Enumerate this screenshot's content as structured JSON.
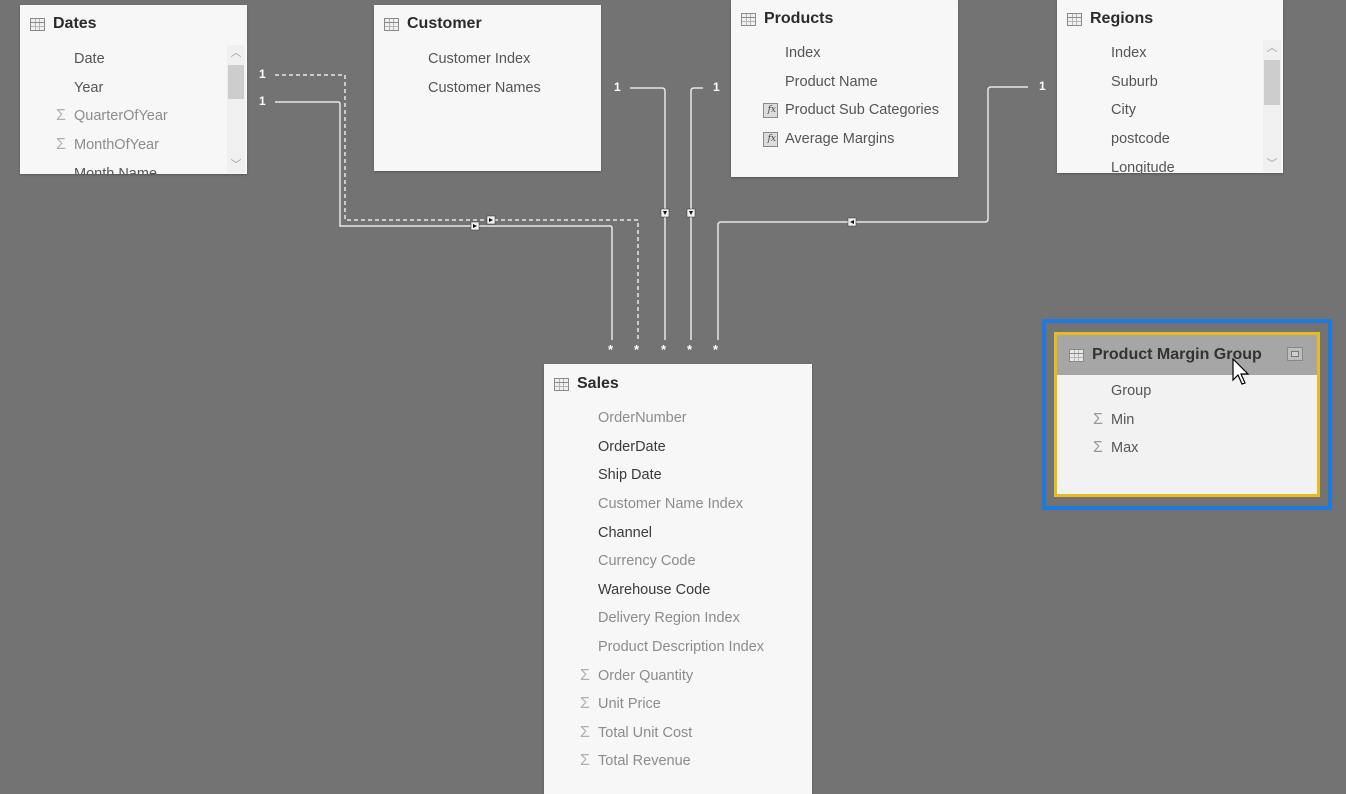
{
  "diagram": {
    "view": "Power BI relationship view",
    "tables": [
      {
        "id": "dates",
        "name": "Dates",
        "has_scrollbar": true,
        "fields": [
          {
            "name": "Date",
            "icon": "none",
            "style": "normal"
          },
          {
            "name": "Year",
            "icon": "none",
            "style": "normal"
          },
          {
            "name": "QuarterOfYear",
            "icon": "sigma-icon",
            "style": "dim"
          },
          {
            "name": "MonthOfYear",
            "icon": "sigma-icon",
            "style": "dim"
          },
          {
            "name": "Month Name",
            "icon": "none",
            "style": "normal"
          }
        ]
      },
      {
        "id": "customer",
        "name": "Customer",
        "has_scrollbar": false,
        "fields": [
          {
            "name": "Customer Index",
            "icon": "none",
            "style": "normal"
          },
          {
            "name": "Customer Names",
            "icon": "none",
            "style": "normal"
          }
        ]
      },
      {
        "id": "products",
        "name": "Products",
        "has_scrollbar": false,
        "fields": [
          {
            "name": "Index",
            "icon": "none",
            "style": "normal"
          },
          {
            "name": "Product Name",
            "icon": "none",
            "style": "normal"
          },
          {
            "name": "Product Sub Categories",
            "icon": "calculated-column-icon",
            "style": "normal"
          },
          {
            "name": "Average Margins",
            "icon": "calculated-column-icon",
            "style": "normal"
          }
        ]
      },
      {
        "id": "regions",
        "name": "Regions",
        "has_scrollbar": true,
        "fields": [
          {
            "name": "Index",
            "icon": "none",
            "style": "normal"
          },
          {
            "name": "Suburb",
            "icon": "none",
            "style": "normal"
          },
          {
            "name": "City",
            "icon": "none",
            "style": "normal"
          },
          {
            "name": "postcode",
            "icon": "none",
            "style": "normal"
          },
          {
            "name": "Longitude",
            "icon": "none",
            "style": "normal"
          }
        ]
      },
      {
        "id": "sales",
        "name": "Sales",
        "has_scrollbar": false,
        "fields": [
          {
            "name": "OrderNumber",
            "icon": "none",
            "style": "dim"
          },
          {
            "name": "OrderDate",
            "icon": "none",
            "style": "dark"
          },
          {
            "name": "Ship Date",
            "icon": "none",
            "style": "dark"
          },
          {
            "name": "Customer Name Index",
            "icon": "none",
            "style": "dim"
          },
          {
            "name": "Channel",
            "icon": "none",
            "style": "dark"
          },
          {
            "name": "Currency Code",
            "icon": "none",
            "style": "dim"
          },
          {
            "name": "Warehouse Code",
            "icon": "none",
            "style": "dark"
          },
          {
            "name": "Delivery Region Index",
            "icon": "none",
            "style": "dim"
          },
          {
            "name": "Product Description Index",
            "icon": "none",
            "style": "dim"
          },
          {
            "name": "Order Quantity",
            "icon": "sigma-icon",
            "style": "dim"
          },
          {
            "name": "Unit Price",
            "icon": "sigma-icon",
            "style": "dim"
          },
          {
            "name": "Total Unit Cost",
            "icon": "sigma-icon",
            "style": "dim"
          },
          {
            "name": "Total Revenue",
            "icon": "sigma-icon",
            "style": "dim"
          }
        ]
      },
      {
        "id": "product-margin-group",
        "name": "Product Margin Group",
        "selected": true,
        "fields": [
          {
            "name": "Group",
            "icon": "none",
            "style": "normal"
          },
          {
            "name": "Min",
            "icon": "sigma-icon",
            "style": "normal"
          },
          {
            "name": "Max",
            "icon": "sigma-icon",
            "style": "normal"
          }
        ]
      }
    ],
    "relationships": [
      {
        "from": "Dates",
        "to": "Sales",
        "from_cardinality": "1",
        "to_cardinality": "*",
        "active": false
      },
      {
        "from": "Dates",
        "to": "Sales",
        "from_cardinality": "1",
        "to_cardinality": "*",
        "active": true
      },
      {
        "from": "Customer",
        "to": "Sales",
        "from_cardinality": "1",
        "to_cardinality": "*",
        "active": true
      },
      {
        "from": "Products",
        "to": "Sales",
        "from_cardinality": "1",
        "to_cardinality": "*",
        "active": true
      },
      {
        "from": "Regions",
        "to": "Sales",
        "from_cardinality": "1",
        "to_cardinality": "*",
        "active": true
      }
    ],
    "cardinality_one": "1",
    "cardinality_many": "*",
    "colors": {
      "canvas": "#737373",
      "selection_outer": "#1f7ae0",
      "selection_inner": "#e6bc20",
      "relationship_line": "#e8e8e8"
    }
  }
}
